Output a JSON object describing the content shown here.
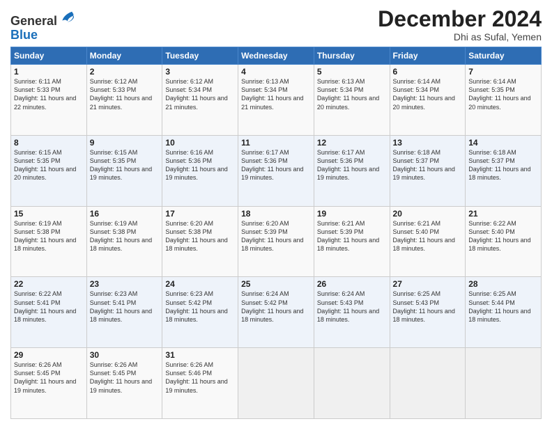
{
  "logo": {
    "line1": "General",
    "line2": "Blue"
  },
  "header": {
    "month": "December 2024",
    "location": "Dhi as Sufal, Yemen"
  },
  "days_of_week": [
    "Sunday",
    "Monday",
    "Tuesday",
    "Wednesday",
    "Thursday",
    "Friday",
    "Saturday"
  ],
  "weeks": [
    [
      {
        "day": 1,
        "sunrise": "6:11 AM",
        "sunset": "5:33 PM",
        "daylight": "11 hours and 22 minutes."
      },
      {
        "day": 2,
        "sunrise": "6:12 AM",
        "sunset": "5:33 PM",
        "daylight": "11 hours and 21 minutes."
      },
      {
        "day": 3,
        "sunrise": "6:12 AM",
        "sunset": "5:34 PM",
        "daylight": "11 hours and 21 minutes."
      },
      {
        "day": 4,
        "sunrise": "6:13 AM",
        "sunset": "5:34 PM",
        "daylight": "11 hours and 21 minutes."
      },
      {
        "day": 5,
        "sunrise": "6:13 AM",
        "sunset": "5:34 PM",
        "daylight": "11 hours and 20 minutes."
      },
      {
        "day": 6,
        "sunrise": "6:14 AM",
        "sunset": "5:34 PM",
        "daylight": "11 hours and 20 minutes."
      },
      {
        "day": 7,
        "sunrise": "6:14 AM",
        "sunset": "5:35 PM",
        "daylight": "11 hours and 20 minutes."
      }
    ],
    [
      {
        "day": 8,
        "sunrise": "6:15 AM",
        "sunset": "5:35 PM",
        "daylight": "11 hours and 20 minutes."
      },
      {
        "day": 9,
        "sunrise": "6:15 AM",
        "sunset": "5:35 PM",
        "daylight": "11 hours and 19 minutes."
      },
      {
        "day": 10,
        "sunrise": "6:16 AM",
        "sunset": "5:36 PM",
        "daylight": "11 hours and 19 minutes."
      },
      {
        "day": 11,
        "sunrise": "6:17 AM",
        "sunset": "5:36 PM",
        "daylight": "11 hours and 19 minutes."
      },
      {
        "day": 12,
        "sunrise": "6:17 AM",
        "sunset": "5:36 PM",
        "daylight": "11 hours and 19 minutes."
      },
      {
        "day": 13,
        "sunrise": "6:18 AM",
        "sunset": "5:37 PM",
        "daylight": "11 hours and 19 minutes."
      },
      {
        "day": 14,
        "sunrise": "6:18 AM",
        "sunset": "5:37 PM",
        "daylight": "11 hours and 18 minutes."
      }
    ],
    [
      {
        "day": 15,
        "sunrise": "6:19 AM",
        "sunset": "5:38 PM",
        "daylight": "11 hours and 18 minutes."
      },
      {
        "day": 16,
        "sunrise": "6:19 AM",
        "sunset": "5:38 PM",
        "daylight": "11 hours and 18 minutes."
      },
      {
        "day": 17,
        "sunrise": "6:20 AM",
        "sunset": "5:38 PM",
        "daylight": "11 hours and 18 minutes."
      },
      {
        "day": 18,
        "sunrise": "6:20 AM",
        "sunset": "5:39 PM",
        "daylight": "11 hours and 18 minutes."
      },
      {
        "day": 19,
        "sunrise": "6:21 AM",
        "sunset": "5:39 PM",
        "daylight": "11 hours and 18 minutes."
      },
      {
        "day": 20,
        "sunrise": "6:21 AM",
        "sunset": "5:40 PM",
        "daylight": "11 hours and 18 minutes."
      },
      {
        "day": 21,
        "sunrise": "6:22 AM",
        "sunset": "5:40 PM",
        "daylight": "11 hours and 18 minutes."
      }
    ],
    [
      {
        "day": 22,
        "sunrise": "6:22 AM",
        "sunset": "5:41 PM",
        "daylight": "11 hours and 18 minutes."
      },
      {
        "day": 23,
        "sunrise": "6:23 AM",
        "sunset": "5:41 PM",
        "daylight": "11 hours and 18 minutes."
      },
      {
        "day": 24,
        "sunrise": "6:23 AM",
        "sunset": "5:42 PM",
        "daylight": "11 hours and 18 minutes."
      },
      {
        "day": 25,
        "sunrise": "6:24 AM",
        "sunset": "5:42 PM",
        "daylight": "11 hours and 18 minutes."
      },
      {
        "day": 26,
        "sunrise": "6:24 AM",
        "sunset": "5:43 PM",
        "daylight": "11 hours and 18 minutes."
      },
      {
        "day": 27,
        "sunrise": "6:25 AM",
        "sunset": "5:43 PM",
        "daylight": "11 hours and 18 minutes."
      },
      {
        "day": 28,
        "sunrise": "6:25 AM",
        "sunset": "5:44 PM",
        "daylight": "11 hours and 18 minutes."
      }
    ],
    [
      {
        "day": 29,
        "sunrise": "6:26 AM",
        "sunset": "5:45 PM",
        "daylight": "11 hours and 19 minutes."
      },
      {
        "day": 30,
        "sunrise": "6:26 AM",
        "sunset": "5:45 PM",
        "daylight": "11 hours and 19 minutes."
      },
      {
        "day": 31,
        "sunrise": "6:26 AM",
        "sunset": "5:46 PM",
        "daylight": "11 hours and 19 minutes."
      },
      null,
      null,
      null,
      null
    ]
  ]
}
